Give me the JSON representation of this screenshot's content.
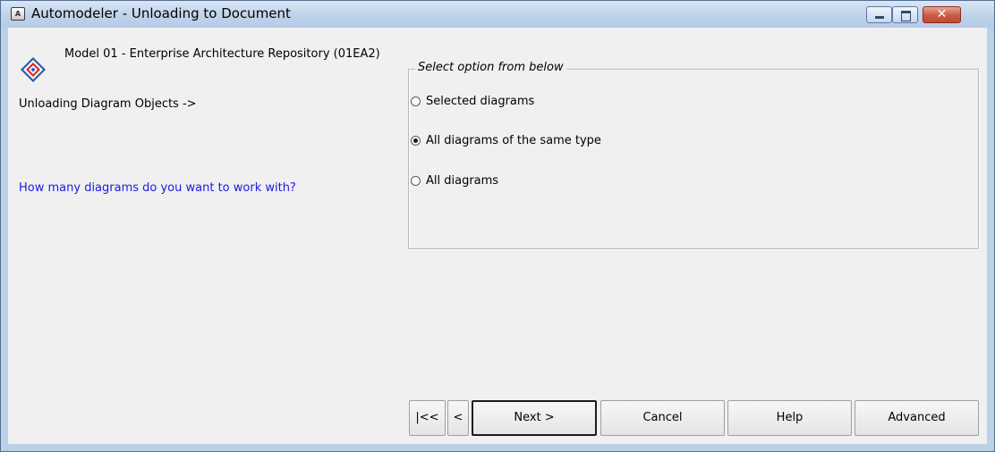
{
  "window": {
    "title": "Automodeler - Unloading to Document",
    "controls": {
      "minimize_label": "",
      "maximize_label": "",
      "close_label": "✕"
    }
  },
  "header": {
    "model_name": "Model 01 - Enterprise Architecture Repository (01EA2)"
  },
  "left_panel": {
    "step_label": "Unloading Diagram Objects ->",
    "question": "How many diagrams do you want to work with?",
    "question_color": "#1a1ae6"
  },
  "options_group": {
    "title": "Select option from below",
    "options": [
      {
        "label": "Selected diagrams",
        "selected": false
      },
      {
        "label": "All diagrams of the same type",
        "selected": true
      },
      {
        "label": "All diagrams",
        "selected": false
      }
    ]
  },
  "footer": {
    "first_label": "|<<",
    "back_label": "<",
    "next_label": "Next >",
    "cancel_label": "Cancel",
    "help_label": "Help",
    "advanced_label": "Advanced"
  },
  "colors": {
    "titlebar": "#bfd3ea",
    "client_bg": "#f0f0f0",
    "close_button": "#c95a41"
  },
  "icons": [
    "app-icon",
    "minimize-icon",
    "maximize-icon",
    "close-icon",
    "logo-icon"
  ]
}
